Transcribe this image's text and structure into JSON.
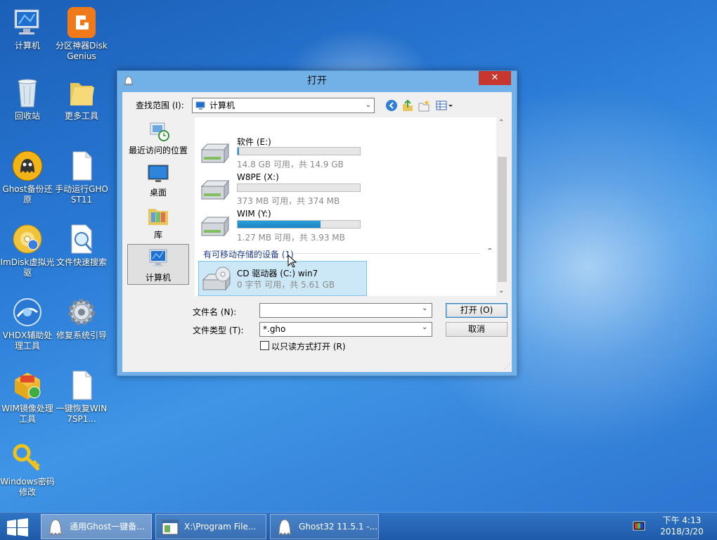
{
  "desktop": {
    "icons": [
      {
        "label": "计算机"
      },
      {
        "label": "分区神器DiskGenius"
      },
      {
        "label": "回收站"
      },
      {
        "label": "更多工具"
      },
      {
        "label": "Ghost备份还原"
      },
      {
        "label": "手动运行GHOST11"
      },
      {
        "label": "ImDisk虚拟光驱"
      },
      {
        "label": "文件快速搜索"
      },
      {
        "label": "VHDX辅助处理工具"
      },
      {
        "label": "修复系统引导"
      },
      {
        "label": "WIM镜像处理工具"
      },
      {
        "label": "一键恢复WIN7SP1..."
      },
      {
        "label": "Windows密码修改"
      }
    ]
  },
  "dialog": {
    "title": "打开",
    "close_label": "✕",
    "look_in_label": "查找范围 (I):",
    "look_in_value": "计算机",
    "places": [
      {
        "label": "最近访问的位置"
      },
      {
        "label": "桌面"
      },
      {
        "label": "库"
      },
      {
        "label": "计算机"
      }
    ],
    "drives": [
      {
        "name": "软件 (E:)",
        "info": "14.8 GB 可用，共 14.9 GB",
        "used_fraction": 0.01
      },
      {
        "name": "W8PE (X:)",
        "info": "373 MB 可用，共 374 MB",
        "used_fraction": 0.0
      },
      {
        "name": "WIM (Y:)",
        "info": "1.27 MB 可用，共 3.93 MB",
        "used_fraction": 0.68
      }
    ],
    "removable_group": "有可移动存储的设备 (1)",
    "cd_drive": {
      "name": "CD 驱动器 (C:) win7",
      "info": "0 字节 可用，共 5.61 GB"
    },
    "filename_label": "文件名 (N):",
    "filename_value": "",
    "filetype_label": "文件类型 (T):",
    "filetype_value": "*.gho",
    "open_button": "打开 (O)",
    "cancel_button": "取消",
    "readonly_label": "以只读方式打开 (R)"
  },
  "taskbar": {
    "buttons": [
      {
        "label": "通用Ghost一键备..."
      },
      {
        "label": "X:\\Program File..."
      },
      {
        "label": "Ghost32 11.5.1 -..."
      }
    ],
    "time": "下午 4:13",
    "date": "2018/3/20"
  }
}
